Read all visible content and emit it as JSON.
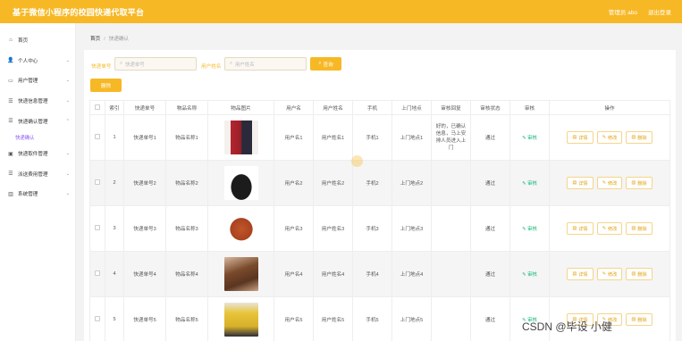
{
  "header": {
    "title": "基于微信小程序的校园快递代取平台",
    "admin": "管理员 abo",
    "logout": "退出登录"
  },
  "sidebar": {
    "items": [
      {
        "label": "首页",
        "icon": "home-icon"
      },
      {
        "label": "个人中心",
        "icon": "user-icon"
      },
      {
        "label": "用户管理",
        "icon": "chat-icon"
      },
      {
        "label": "快递信息管理",
        "icon": "list-icon"
      },
      {
        "label": "快递确认管理",
        "icon": "list-icon"
      },
      {
        "label": "快递取件管理",
        "icon": "box-icon"
      },
      {
        "label": "派送费用管理",
        "icon": "list-icon"
      },
      {
        "label": "系统管理",
        "icon": "chart-icon"
      }
    ],
    "active_sub": "快递确认"
  },
  "breadcrumb": {
    "home": "首页",
    "sep": "/",
    "current": "快递确认"
  },
  "search": {
    "label1": "快递单号",
    "placeholder1": "快递单号",
    "label2": "用户姓名",
    "placeholder2": "用户姓名",
    "button": "查询"
  },
  "actions": {
    "delete": "删除"
  },
  "table": {
    "headers": [
      "",
      "索引",
      "快递单号",
      "物品名称",
      "物品图片",
      "用户名",
      "用户姓名",
      "手机",
      "上门地点",
      "审核回复",
      "审核状态",
      "审核",
      "操作"
    ],
    "approve_label": "审核",
    "ops": {
      "detail": "详情",
      "edit": "修改",
      "delete": "删除"
    },
    "rows": [
      {
        "index": "1",
        "no": "快递单号1",
        "name": "物品名称1",
        "user": "用户名1",
        "uname": "用户姓名1",
        "phone": "手机1",
        "addr": "上门地点1",
        "reply": "好的，已确认信息，马上安排人员进入上门",
        "status": "通过",
        "img": "clothing"
      },
      {
        "index": "2",
        "no": "快递单号2",
        "name": "物品名称2",
        "user": "用户名2",
        "uname": "用户姓名2",
        "phone": "手机2",
        "addr": "上门地点2",
        "reply": "",
        "status": "通过",
        "img": "handbag"
      },
      {
        "index": "3",
        "no": "快递单号3",
        "name": "物品名称3",
        "user": "用户名3",
        "uname": "用户姓名3",
        "phone": "手机3",
        "addr": "上门地点3",
        "reply": "",
        "status": "通过",
        "img": "basketball"
      },
      {
        "index": "4",
        "no": "快递单号4",
        "name": "物品名称4",
        "user": "用户名4",
        "uname": "用户姓名4",
        "phone": "手机4",
        "addr": "上门地点4",
        "reply": "",
        "status": "通过",
        "img": "brown-bag"
      },
      {
        "index": "5",
        "no": "快递单号5",
        "name": "物品名称5",
        "user": "用户名5",
        "uname": "用户姓名5",
        "phone": "手机5",
        "addr": "上门地点5",
        "reply": "",
        "status": "通过",
        "img": "yellow-shirt"
      }
    ]
  },
  "watermark": "CSDN @毕设 小健"
}
